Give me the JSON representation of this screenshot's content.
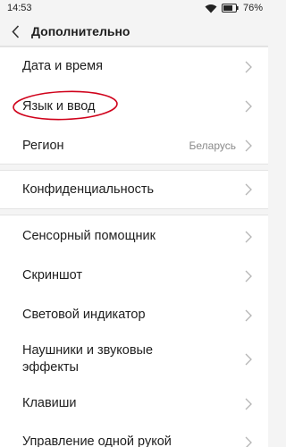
{
  "status": {
    "time": "14:53",
    "battery": "76%"
  },
  "header": {
    "title": "Дополнительно"
  },
  "groups": [
    {
      "items": [
        {
          "label": "Дата и время"
        },
        {
          "label": "Язык и ввод"
        },
        {
          "label": "Регион",
          "value": "Беларусь"
        }
      ]
    },
    {
      "items": [
        {
          "label": "Конфиденциальность"
        }
      ]
    },
    {
      "items": [
        {
          "label": "Сенсорный помощник"
        },
        {
          "label": "Скриншот"
        },
        {
          "label": "Световой индикатор"
        },
        {
          "label": "Наушники и звуковые эффекты",
          "line1": "Наушники и звуковые",
          "line2": "эффекты"
        },
        {
          "label": "Клавиши"
        },
        {
          "label": "Управление одной рукой"
        }
      ]
    }
  ],
  "annotation": {
    "color": "#d0021b",
    "target": "Язык и ввод"
  }
}
